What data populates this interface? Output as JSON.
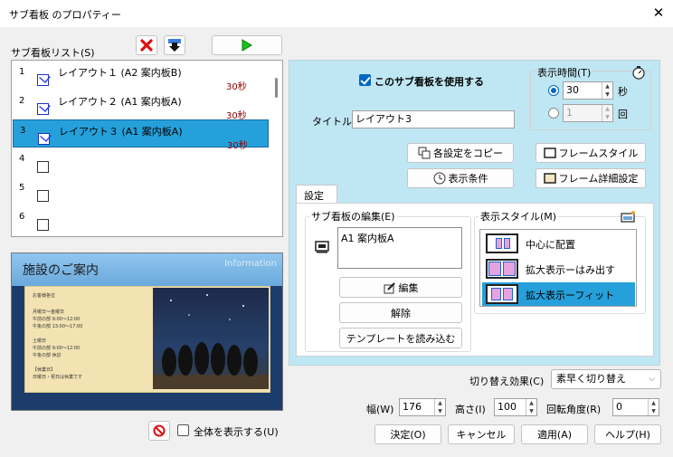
{
  "window": {
    "title": "サブ看板 のプロパティー",
    "close_glyph": "✕"
  },
  "list": {
    "label": "サブ看板リスト(S)",
    "rows": [
      {
        "num": "1",
        "name": "レイアウト１ (A2 案内板B)",
        "duration": "30秒",
        "checked": true,
        "selected": false
      },
      {
        "num": "2",
        "name": "レイアウト２ (A1 案内板A)",
        "duration": "30秒",
        "checked": true,
        "selected": false
      },
      {
        "num": "3",
        "name": "レイアウト３ (A1 案内板A)",
        "duration": "30秒",
        "checked": true,
        "selected": true
      },
      {
        "num": "4",
        "name": "",
        "duration": "",
        "checked": false,
        "selected": false
      },
      {
        "num": "5",
        "name": "",
        "duration": "",
        "checked": false,
        "selected": false
      },
      {
        "num": "6",
        "name": "",
        "duration": "",
        "checked": false,
        "selected": false
      }
    ]
  },
  "preview": {
    "heading": "施設のご案内",
    "info_label": "Information",
    "lines": [
      "お客様各位",
      "月曜日～金曜日",
      "午前の部 9:00～12:00",
      "午後の部 13:00～17:00",
      "土曜日",
      "午前の部 9:00～12:00",
      "午後の部 休診",
      "【休業日】",
      "日曜日・祝日は休業です"
    ]
  },
  "toolbar": {
    "delete_icon": "red-x-icon",
    "down_icon": "down-arrow-icon",
    "play_icon": "play-icon"
  },
  "use_sub": {
    "label": "このサブ看板を使用する",
    "checked": true
  },
  "title_field": {
    "label": "タイトル",
    "value": "レイアウト3"
  },
  "display_time": {
    "label": "表示時間(T)",
    "seconds_value": "30",
    "seconds_unit": "秒",
    "count_value": "1",
    "count_unit": "回",
    "mode": "seconds"
  },
  "buttons": {
    "copy_settings": "各設定をコピー",
    "display_condition": "表示条件",
    "frame_style": "フレームスタイル",
    "frame_detail": "フレーム詳細設定",
    "edit": "編集",
    "release": "解除",
    "load_template": "テンプレートを読み込む",
    "ok": "決定(O)",
    "cancel": "キャンセル",
    "apply": "適用(A)",
    "help": "ヘルプ(H)"
  },
  "settings_tab": {
    "label": "設定"
  },
  "sub_edit": {
    "label": "サブ看板の編集(E)",
    "content": "A1 案内板A"
  },
  "display_style": {
    "label": "表示スタイル(M)",
    "options": [
      "中心に配置",
      "拡大表示ーはみ出す",
      "拡大表示ーフィット"
    ],
    "selected_index": 2
  },
  "transition": {
    "label": "切り替え効果(C)",
    "value": "素早く切り替え"
  },
  "size": {
    "width_label": "幅(W)",
    "width_value": "176",
    "height_label": "高さ(I)",
    "height_value": "100",
    "rotation_label": "回転角度(R)",
    "rotation_value": "0"
  },
  "show_all": {
    "label": "全体を表示する(U)",
    "checked": false
  },
  "colors": {
    "selection": "#26a0da",
    "panel": "#bfe7f3",
    "accent": "#0067c0"
  }
}
